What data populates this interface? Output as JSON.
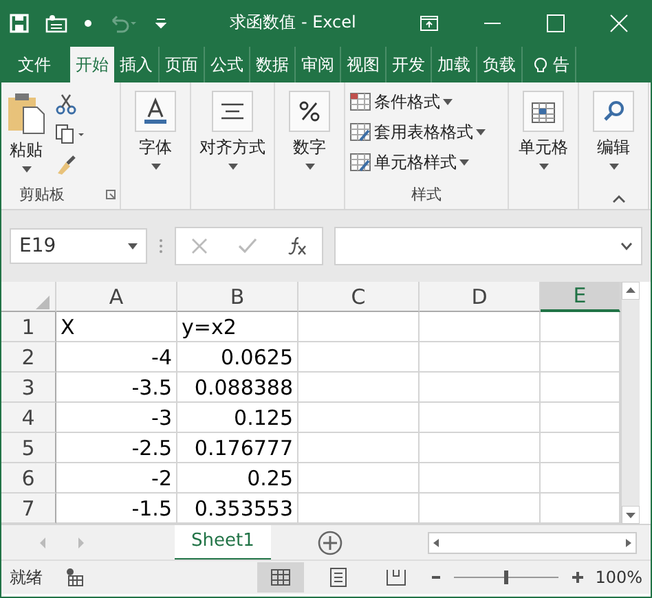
{
  "window": {
    "title": "求函数值 - Excel"
  },
  "tabs": [
    {
      "label": "文件",
      "selected": false
    },
    {
      "label": "开始",
      "selected": true
    },
    {
      "label": "插入",
      "selected": false
    },
    {
      "label": "页面",
      "selected": false
    },
    {
      "label": "公式",
      "selected": false
    },
    {
      "label": "数据",
      "selected": false
    },
    {
      "label": "审阅",
      "selected": false
    },
    {
      "label": "视图",
      "selected": false
    },
    {
      "label": "开发",
      "selected": false
    },
    {
      "label": "加载",
      "selected": false
    },
    {
      "label": "负载",
      "selected": false
    },
    {
      "label": "告",
      "selected": false
    }
  ],
  "ribbon": {
    "clipboard": {
      "paste": "粘贴",
      "label": "剪贴板"
    },
    "buttons": [
      {
        "label": "字体",
        "kind": "font"
      },
      {
        "label": "对齐方式",
        "kind": "align"
      },
      {
        "label": "数字",
        "kind": "number"
      }
    ],
    "styles": {
      "items": [
        {
          "label": "条件格式"
        },
        {
          "label": "套用表格格式"
        },
        {
          "label": "单元格样式"
        }
      ],
      "label": "样式"
    },
    "buttons_right": [
      {
        "label": "单元格",
        "kind": "cells"
      },
      {
        "label": "编辑",
        "kind": "edit"
      }
    ]
  },
  "name_box": "E19",
  "sheet": {
    "columns": [
      {
        "label": "A",
        "selected": false
      },
      {
        "label": "B",
        "selected": false
      },
      {
        "label": "C",
        "selected": false
      },
      {
        "label": "D",
        "selected": false
      },
      {
        "label": "E",
        "selected": true
      }
    ],
    "rows": [
      {
        "number": "1",
        "cells": [
          "X",
          "y=x2"
        ]
      },
      {
        "number": "2",
        "cells": [
          "-4",
          "0.0625"
        ]
      },
      {
        "number": "3",
        "cells": [
          "-3.5",
          "0.088388"
        ]
      },
      {
        "number": "4",
        "cells": [
          "-3",
          "0.125"
        ]
      },
      {
        "number": "5",
        "cells": [
          "-2.5",
          "0.176777"
        ]
      },
      {
        "number": "6",
        "cells": [
          "-2",
          "0.25"
        ]
      },
      {
        "number": "7",
        "cells": [
          "-1.5",
          "0.353553"
        ]
      }
    ]
  },
  "sheet_tabs": [
    {
      "label": "Sheet1",
      "selected": true
    }
  ],
  "status_bar": {
    "status": "就绪",
    "zoom_slider": {
      "level": 0.5
    },
    "zoom": "100%"
  }
}
